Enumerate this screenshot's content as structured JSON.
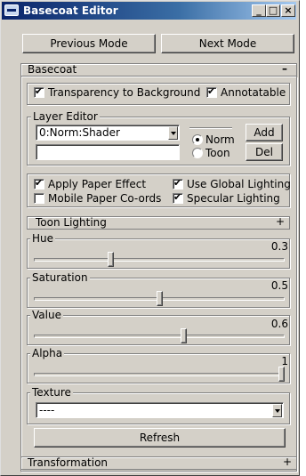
{
  "window": {
    "title": "Basecoat Editor",
    "minimize": "_",
    "maximize": "□",
    "close": "×"
  },
  "toolbar": {
    "previous_mode": "Previous Mode",
    "next_mode": "Next Mode"
  },
  "basecoat": {
    "label": "Basecoat",
    "collapse": "–",
    "transparency": {
      "label": "Transparency to Background",
      "checked": true
    },
    "annotatable": {
      "label": "Annotatable",
      "checked": true
    }
  },
  "layer_editor": {
    "label": "Layer Editor",
    "selected_layer": "0:Norm:Shader",
    "name_value": "",
    "radio_norm": {
      "label": "Norm",
      "checked": true
    },
    "radio_toon": {
      "label": "Toon",
      "checked": false
    },
    "add": "Add",
    "del": "Del"
  },
  "options": {
    "apply_paper": {
      "label": "Apply Paper Effect",
      "checked": true
    },
    "use_global": {
      "label": "Use Global Lighting",
      "checked": true
    },
    "mobile_paper": {
      "label": "Mobile Paper Co-ords",
      "checked": false
    },
    "specular": {
      "label": "Specular Lighting",
      "checked": true
    }
  },
  "toon_lighting": {
    "label": "Toon Lighting",
    "expand": "+"
  },
  "sliders": {
    "hue": {
      "label": "Hue",
      "value": "0.3",
      "level": 0.3
    },
    "saturation": {
      "label": "Saturation",
      "value": "0.5",
      "level": 0.5
    },
    "value": {
      "label": "Value",
      "value": "0.6",
      "level": 0.6
    },
    "alpha": {
      "label": "Alpha",
      "value": "1",
      "level": 1.0
    }
  },
  "texture": {
    "label": "Texture",
    "selected": "----"
  },
  "refresh": "Refresh",
  "transformation": {
    "label": "Transformation",
    "expand": "+"
  }
}
